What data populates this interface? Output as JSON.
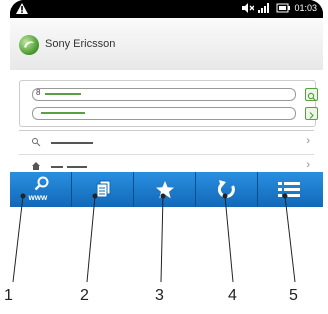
{
  "status": {
    "time": "01:03"
  },
  "brand": {
    "name": "Sony Ericsson"
  },
  "search_field": {
    "prefix": "8"
  },
  "toolbar": {
    "items": [
      {
        "id": "www",
        "label": "www",
        "icon": "search-icon"
      },
      {
        "id": "bookmarks",
        "icon": "pages-icon"
      },
      {
        "id": "favorite",
        "icon": "star-icon"
      },
      {
        "id": "refresh",
        "icon": "refresh-icon"
      },
      {
        "id": "menu",
        "icon": "list-icon"
      }
    ]
  },
  "callouts": [
    "1",
    "2",
    "3",
    "4",
    "5"
  ],
  "colors": {
    "accent": "#1a7ed6",
    "green": "#58a040"
  }
}
